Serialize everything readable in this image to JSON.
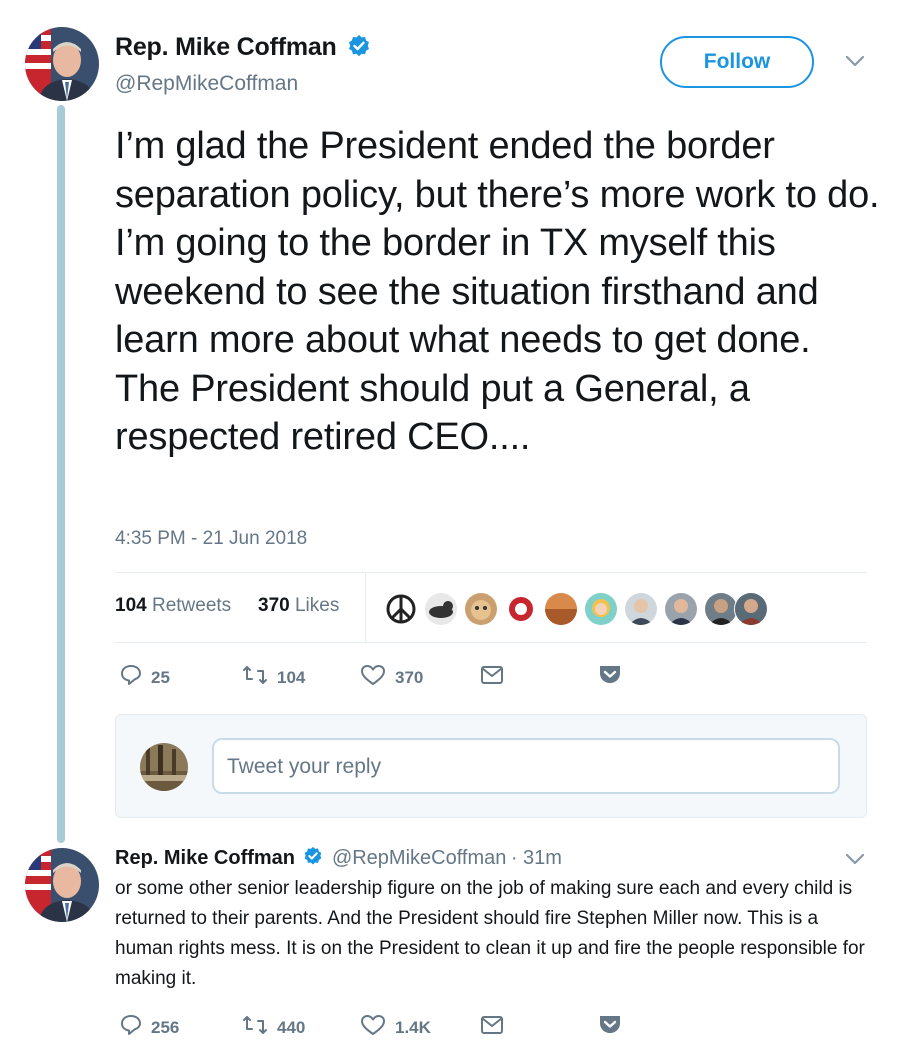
{
  "tweet": {
    "author_name": "Rep. Mike Coffman",
    "author_handle": "@RepMikeCoffman",
    "follow_label": "Follow",
    "text": "I’m glad the President ended the border separation policy, but there’s more work to do. I’m going to the border in TX myself this weekend to see the situation firsthand and learn more about what needs to get done. The President should put a General, a respected retired CEO....",
    "timestamp": "4:35 PM - 21 Jun 2018",
    "retweets_count": "104",
    "retweets_label": "Retweets",
    "likes_count": "370",
    "likes_label": "Likes",
    "actions": {
      "replies": "25",
      "retweets": "104",
      "likes": "370"
    }
  },
  "reply_composer": {
    "placeholder": "Tweet your reply"
  },
  "reply_tweet": {
    "author_name": "Rep. Mike Coffman",
    "author_handle": "@RepMikeCoffman",
    "time_ago": "· 31m",
    "text": "or some other senior leadership figure on the job of making sure each and every child is returned to their parents. And the President should fire Stephen Miller now. This is a human rights mess. It is on the President to clean it up and fire the people responsible for making it.",
    "actions": {
      "replies": "256",
      "retweets": "440",
      "likes": "1.4K"
    }
  },
  "colors": {
    "accent": "#1b95e0",
    "muted": "#657786",
    "thread": "#a8cbd8"
  }
}
